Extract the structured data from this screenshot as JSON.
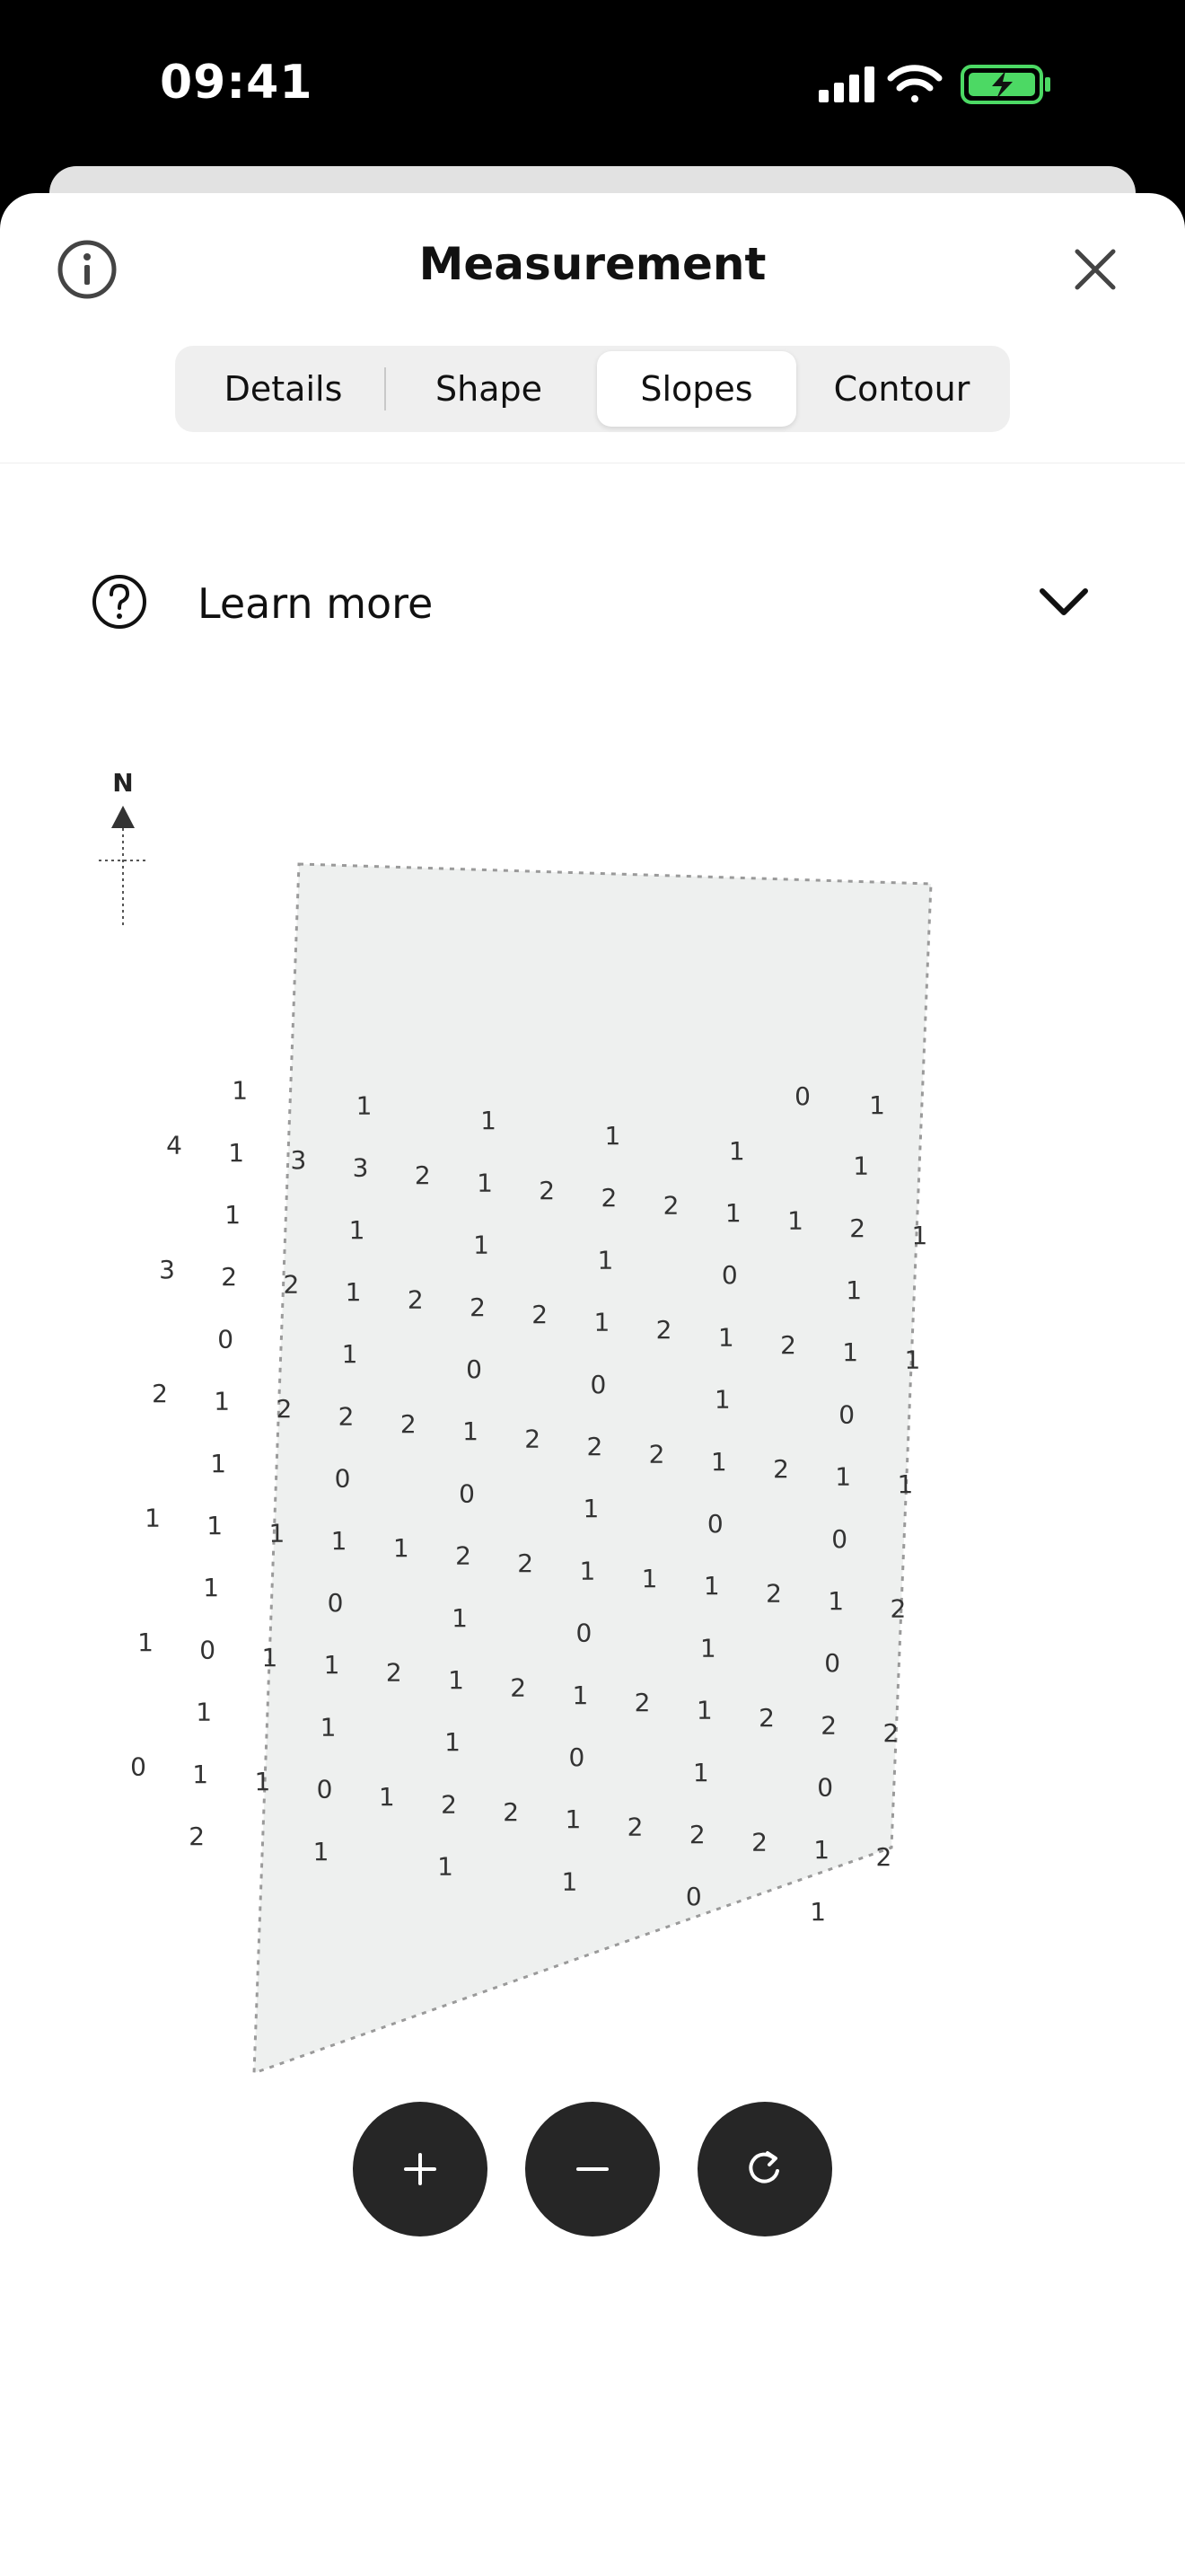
{
  "status_bar": {
    "time": "09:41",
    "icons": [
      "cellular-icon",
      "wifi-icon",
      "battery-charging-icon"
    ],
    "battery_color": "#4cd964"
  },
  "sheet": {
    "title": "Measurement",
    "info_icon": "info-icon",
    "close_icon": "close-icon",
    "tabs": [
      {
        "label": "Details",
        "active": false
      },
      {
        "label": "Shape",
        "active": false
      },
      {
        "label": "Slopes",
        "active": true
      },
      {
        "label": "Contour",
        "active": false
      }
    ],
    "learn_more": {
      "label": "Learn more",
      "icon": "help-circle-icon",
      "chevron": "chevron-down-icon"
    }
  },
  "map": {
    "compass_label": "N",
    "fill_color": "#eef0ef",
    "slope_rows": [
      [
        "0",
        "1"
      ],
      [
        "1",
        "1",
        "1",
        "1",
        "1",
        "1"
      ],
      [
        "4",
        "1",
        "3",
        "3",
        "2",
        "1",
        "2",
        "2",
        "2",
        "1",
        "1",
        "2",
        "1"
      ],
      [
        "1",
        "1",
        "1",
        "1",
        "0",
        "1"
      ],
      [
        "3",
        "2",
        "2",
        "1",
        "2",
        "2",
        "2",
        "1",
        "2",
        "1",
        "2",
        "1",
        "1"
      ],
      [
        "0",
        "1",
        "0",
        "0",
        "1",
        "0"
      ],
      [
        "2",
        "1",
        "2",
        "2",
        "2",
        "1",
        "2",
        "2",
        "2",
        "1",
        "2",
        "1",
        "1"
      ],
      [
        "1",
        "0",
        "0",
        "1",
        "0",
        "0"
      ],
      [
        "1",
        "1",
        "1",
        "1",
        "1",
        "2",
        "2",
        "1",
        "1",
        "1",
        "2",
        "1",
        "2"
      ],
      [
        "1",
        "0",
        "1",
        "0",
        "1",
        "0"
      ],
      [
        "1",
        "0",
        "1",
        "1",
        "2",
        "1",
        "2",
        "1",
        "2",
        "1",
        "2",
        "2",
        "2"
      ],
      [
        "1",
        "1",
        "1",
        "0",
        "1",
        "0"
      ],
      [
        "0",
        "1",
        "1",
        "0",
        "1",
        "2",
        "2",
        "1",
        "2",
        "2",
        "2",
        "1",
        "2"
      ],
      [
        "2",
        "1",
        "1",
        "1",
        "0",
        "1"
      ]
    ]
  },
  "controls": [
    {
      "icon": "zoom-in-icon"
    },
    {
      "icon": "zoom-out-icon"
    },
    {
      "icon": "reset-rotate-icon"
    }
  ]
}
